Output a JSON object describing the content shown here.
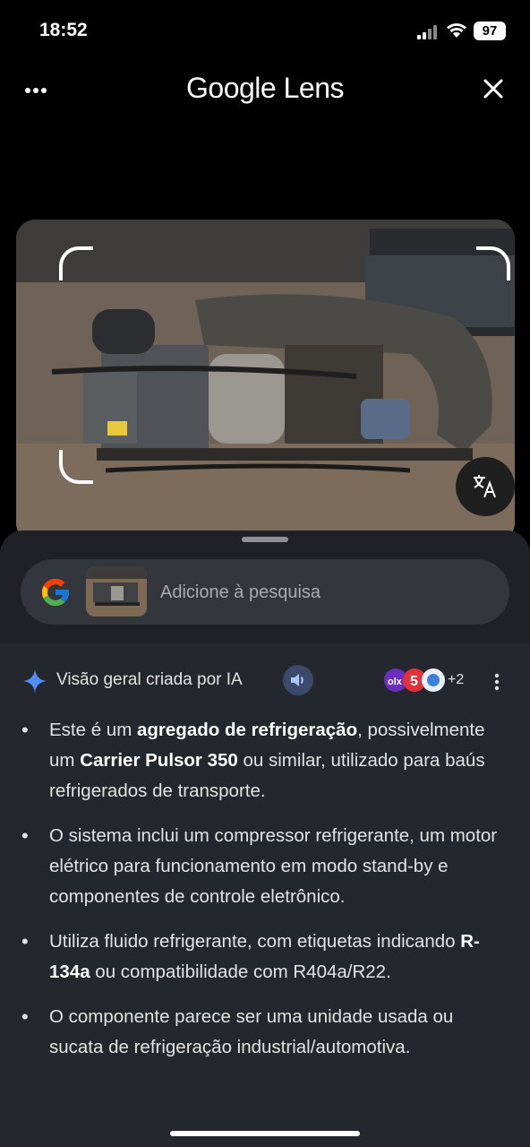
{
  "status_bar": {
    "time": "18:52",
    "battery": "97"
  },
  "header": {
    "title": "Google Lens"
  },
  "search": {
    "placeholder": "Adicione à pesquisa"
  },
  "ai_overview": {
    "title": "Visão geral criada por IA",
    "sources_more": "+2",
    "bullets": [
      {
        "parts": [
          "Este é um ",
          "agregado de refrigeração",
          ", possivelmente um ",
          "Carrier Pulsor 350",
          " ou similar, utilizado para baús refrigerados de transporte."
        ]
      },
      {
        "parts": [
          "O sistema inclui um compressor refrigerante, um motor elétrico para funcionamento em modo stand-by e componentes de controle eletrônico."
        ]
      },
      {
        "parts": [
          "Utiliza fluido refrigerante, com etiquetas indicando ",
          "R-134a",
          " ou compatibilidade com R404a/R22."
        ]
      },
      {
        "parts": [
          "O componente parece ser uma unidade usada ou sucata de refrigeração industrial/automotiva."
        ]
      }
    ]
  },
  "icons": [
    "more-horizontal-icon",
    "close-icon",
    "translate-icon",
    "google-g-icon",
    "ai-sparkle-icon",
    "speaker-icon",
    "more-vertical-icon",
    "share-icon",
    "thumbs-up-icon",
    "copy-icon"
  ],
  "colors": {
    "sheet": "#1f2126",
    "searchbar": "#33363c",
    "ai_blue": "#4f8df7"
  }
}
